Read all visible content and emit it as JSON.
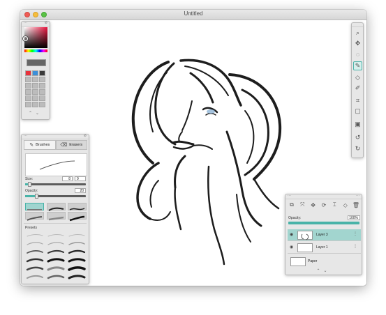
{
  "window": {
    "title": "Untitled"
  },
  "color_panel": {
    "current_color": "#666666",
    "swatches": [
      "#e8323c",
      "#3b8fd9",
      "#3a3a3a"
    ],
    "hue_marker_color": "#e8123c"
  },
  "brush_panel": {
    "tabs": [
      {
        "label": "Brushes",
        "icon": "brush-icon"
      },
      {
        "label": "Erasers",
        "icon": "eraser-icon"
      }
    ],
    "size": {
      "label": "Size:",
      "value": "8",
      "max": "9"
    },
    "opacity": {
      "label": "Opacity:",
      "value": "20"
    },
    "presets_label": "Presets",
    "accent": "#49b3a8"
  },
  "toolbar": {
    "tools": [
      "zoom-icon",
      "move-icon",
      "lasso-icon",
      "brush-icon",
      "eraser-icon",
      "smudge-icon",
      "crop-icon",
      "selection-icon",
      "image-icon",
      "undo-icon",
      "redo-icon"
    ],
    "active": "brush-icon"
  },
  "layers_panel": {
    "tools": [
      "duplicate-icon",
      "transform-icon",
      "move-icon",
      "rotate-icon",
      "text-icon",
      "eraser-icon",
      "trash-icon"
    ],
    "opacity_label": "Opacity:",
    "opacity_value": "100%",
    "layers": [
      {
        "name": "Layer 3",
        "selected": true
      },
      {
        "name": "Layer 1",
        "selected": false
      },
      {
        "name": "Paper",
        "selected": false
      }
    ]
  }
}
